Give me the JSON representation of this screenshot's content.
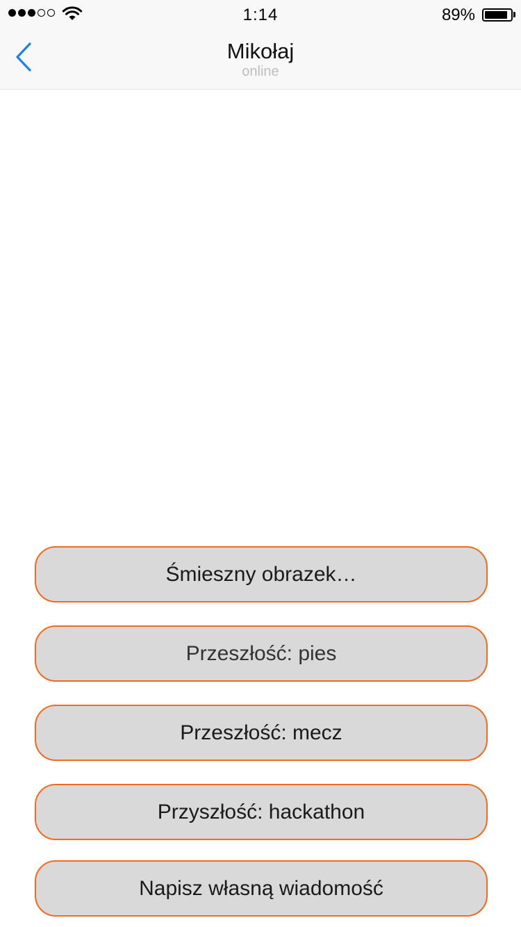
{
  "status_bar": {
    "time": "1:14",
    "battery_percent": "89%",
    "battery_level": 0.89,
    "signal_bars_filled": 3,
    "signal_bars_total": 5,
    "icons": [
      "signal-dots-icon",
      "wifi-icon",
      "battery-icon"
    ]
  },
  "header": {
    "title": "Mikołaj",
    "subtitle": "online",
    "back_icon": "chevron-left-icon",
    "accent_color": "#1a82e2"
  },
  "options": [
    {
      "label": "Śmieszny obrazek…"
    },
    {
      "label": "Przeszłość: pies"
    },
    {
      "label": "Przeszłość: mecz"
    },
    {
      "label": "Przyszłość: hackathon"
    },
    {
      "label": "Napisz własną wiadomość"
    }
  ],
  "colors": {
    "button_border": "#f26a1b",
    "button_fill": "#d9d9d9"
  }
}
